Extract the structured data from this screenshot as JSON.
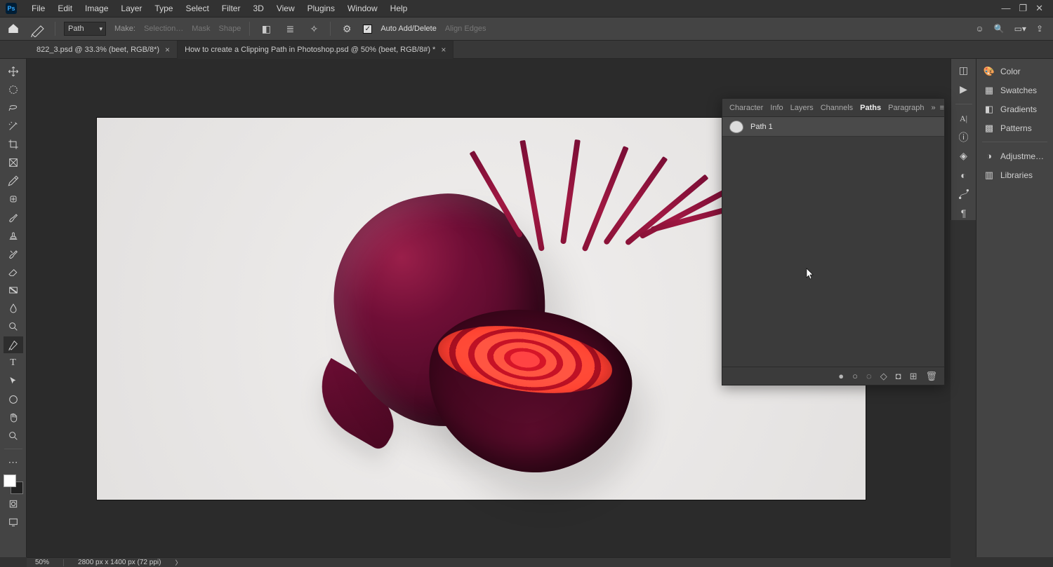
{
  "menu": {
    "items": [
      "File",
      "Edit",
      "Image",
      "Layer",
      "Type",
      "Select",
      "Filter",
      "3D",
      "View",
      "Plugins",
      "Window",
      "Help"
    ]
  },
  "options": {
    "mode": "Path",
    "make_label": "Make:",
    "selection_label": "Selection…",
    "mask_label": "Mask",
    "shape_label": "Shape",
    "auto_add_delete": "Auto Add/Delete",
    "align_edges": "Align Edges"
  },
  "tabs": {
    "inactive": "822_3.psd @ 33.3% (beet, RGB/8*)",
    "active": "How to create a Clipping Path in Photoshop.psd @ 50% (beet, RGB/8#) *"
  },
  "right_panels": {
    "items": [
      "Color",
      "Swatches",
      "Gradients",
      "Patterns",
      "Adjustme…",
      "Libraries"
    ]
  },
  "paths_panel": {
    "tabs": [
      "Character",
      "Info",
      "Layers",
      "Channels",
      "Paths",
      "Paragraph"
    ],
    "active_tab": "Paths",
    "items": [
      {
        "name": "Path 1"
      }
    ]
  },
  "status": {
    "zoom": "50%",
    "dims": "2800 px x 1400 px (72 ppi)"
  }
}
